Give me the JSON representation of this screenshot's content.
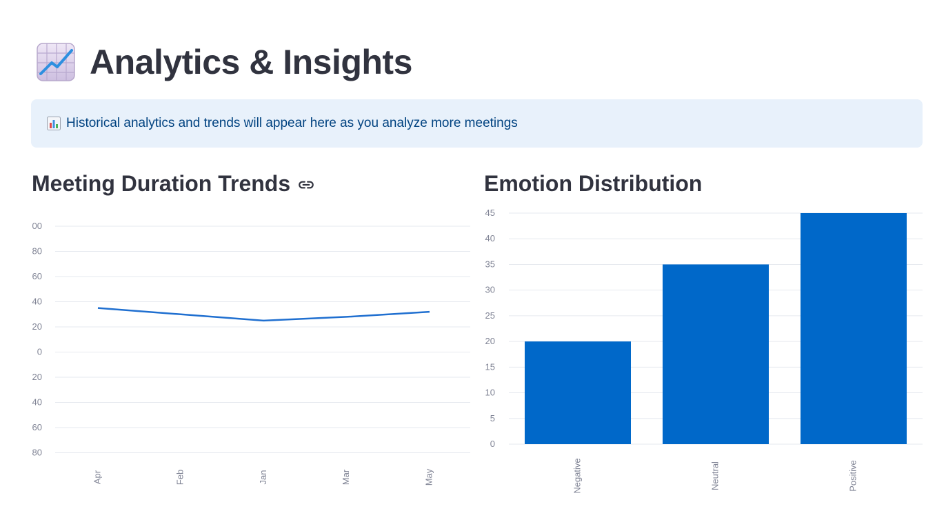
{
  "header": {
    "title": "Analytics & Insights",
    "icon": "chart-increasing-icon"
  },
  "info": {
    "icon": "bar-chart-icon",
    "text": "Historical analytics and trends will appear here as you analyze more meetings"
  },
  "duration_section": {
    "title": "Meeting Duration Trends",
    "link_icon": "link-icon"
  },
  "emotion_section": {
    "title": "Emotion Distribution"
  },
  "colors": {
    "line": "#1f6fd0",
    "bar": "#0068c9",
    "grid": "#e6e9ef",
    "tick": "#808495",
    "info_bg": "#e8f1fb",
    "info_text": "#004280"
  },
  "chart_data": [
    {
      "type": "line",
      "title": "",
      "categories": [
        "Apr",
        "Feb",
        "Jan",
        "Mar",
        "May"
      ],
      "values": [
        35,
        30,
        25,
        28,
        32
      ],
      "y_tick_labels": [
        "00",
        "80",
        "60",
        "40",
        "20",
        "0",
        "20",
        "40",
        "60",
        "80"
      ],
      "xlabel": "",
      "ylabel": "",
      "grid": true
    },
    {
      "type": "bar",
      "title": "",
      "categories": [
        "Negative",
        "Neutral",
        "Positive"
      ],
      "values": [
        20,
        35,
        45
      ],
      "yticks": [
        0,
        5,
        10,
        15,
        20,
        25,
        30,
        35,
        40,
        45
      ],
      "ylim": [
        0,
        45
      ],
      "xlabel": "",
      "ylabel": "",
      "grid": true
    }
  ]
}
